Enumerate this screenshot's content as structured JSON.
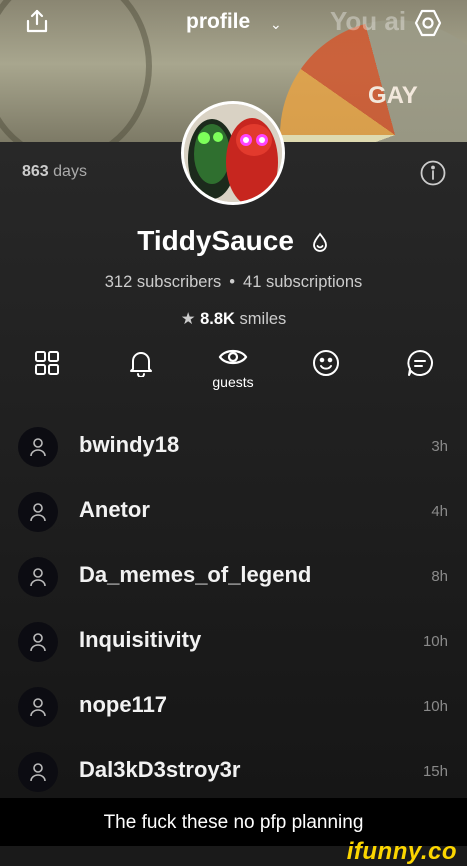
{
  "header": {
    "title": "profile",
    "banner_ghost_text": "You ai",
    "banner_label": "GAY"
  },
  "profile": {
    "days_count": "863",
    "days_label": "days",
    "username": "TiddySauce",
    "subscribers": "312 subscribers",
    "subscriptions": "41 subscriptions",
    "smiles_count": "8.8K",
    "smiles_label": "smiles"
  },
  "tabs": {
    "active_label": "guests"
  },
  "guests": [
    {
      "name": "bwindy18",
      "time": "3h"
    },
    {
      "name": "Anetor",
      "time": "4h"
    },
    {
      "name": "Da_memes_of_legend",
      "time": "8h"
    },
    {
      "name": "Inquisitivity",
      "time": "10h"
    },
    {
      "name": "nope117",
      "time": "10h"
    },
    {
      "name": "Dal3kD3stroy3r",
      "time": "15h"
    }
  ],
  "caption": "The fuck these no pfp planning",
  "watermark": "ifunny.co",
  "colors": {
    "accent_yellow": "#fcd600",
    "background": "#1a1a1a",
    "avatar_bg": "#0c0c12"
  }
}
